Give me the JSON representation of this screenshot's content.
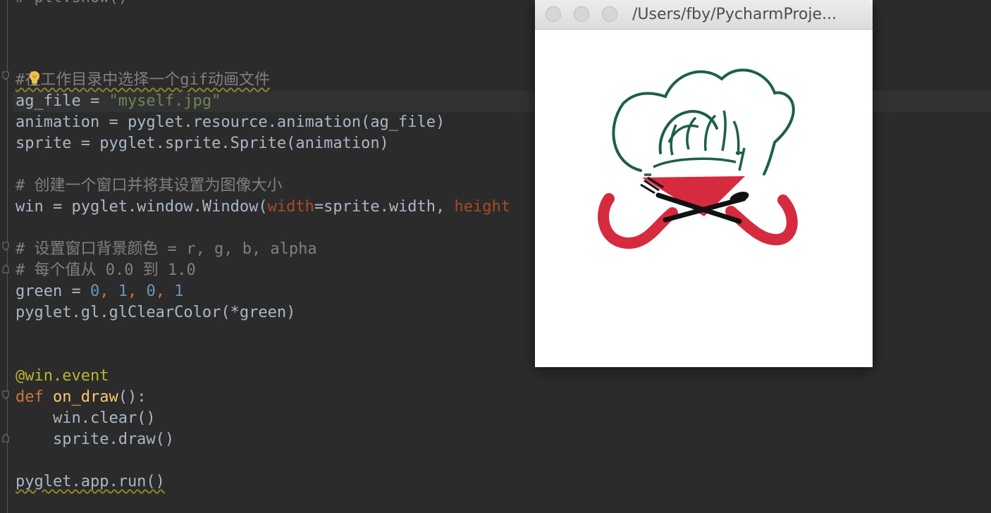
{
  "editor": {
    "lines": {
      "l0": "# plt.show()",
      "l1": "#在工作目录中选择一个gif动画文件",
      "l2a": "ag_file = ",
      "l2b": "\"myself.jpg\"",
      "l3": "animation = pyglet.resource.animation(ag_file)",
      "l4": "sprite = pyglet.sprite.Sprite(animation)",
      "l5": "# 创建一个窗口并将其设置为图像大小",
      "l6a": "win = pyglet.window.Window(",
      "l6b": "width",
      "l6c": "=sprite.width, ",
      "l6d": "height",
      "l7": "# 设置窗口背景颜色 = r, g, b, alpha",
      "l8": "# 每个值从 0.0 到 1.0",
      "l9a": "green = ",
      "l9b": "0",
      "l9c": ", ",
      "l9d": "1",
      "l9e": ", ",
      "l9f": "0",
      "l9g": ", ",
      "l9h": "1",
      "l10": "pyglet.gl.glClearColor(*green)",
      "l11": "@win.event",
      "l12a": "def ",
      "l12b": "on_draw",
      "l12c": "():",
      "l13": "    win.clear()",
      "l14": "    sprite.draw()",
      "l15": "pyglet.app.run()"
    }
  },
  "window": {
    "title": "/Users/fby/PycharmProje..."
  },
  "icons": {
    "bulb": "lightbulb-icon",
    "fold": "fold-marker-icon",
    "close": "close-button",
    "minimize": "minimize-button",
    "zoom": "zoom-button"
  },
  "colors": {
    "editor_bg": "#2b2b2b",
    "comment": "#808080",
    "string": "#6a8759",
    "number": "#6897bb",
    "keyword": "#cc7832",
    "logo_green": "#1f5e4c",
    "logo_red": "#d62a3e"
  }
}
